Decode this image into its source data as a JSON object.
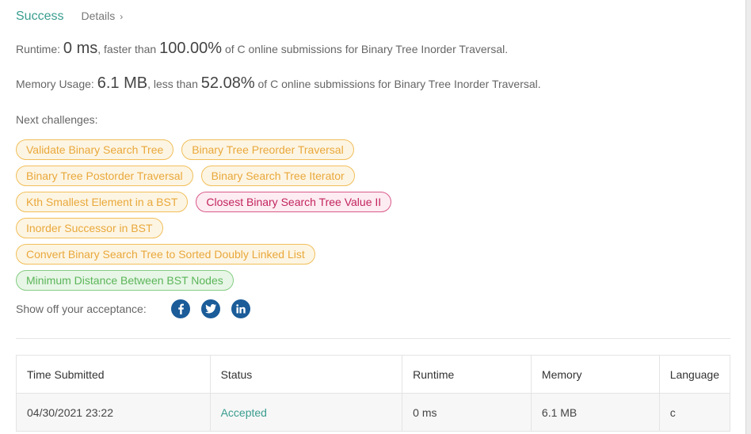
{
  "header": {
    "status": "Success",
    "details_label": "Details",
    "details_chevron": "›"
  },
  "runtime": {
    "label": "Runtime:",
    "value": "0 ms",
    "mid": ", faster than",
    "percent": "100.00%",
    "tail": "of C online submissions for Binary Tree Inorder Traversal."
  },
  "memory": {
    "label": "Memory Usage:",
    "value": "6.1 MB",
    "mid": ", less than",
    "percent": "52.08%",
    "tail": "of C online submissions for Binary Tree Inorder Traversal."
  },
  "next_challenges": {
    "label": "Next challenges:",
    "rows": [
      [
        {
          "title": "Validate Binary Search Tree",
          "difficulty": "medium"
        },
        {
          "title": "Binary Tree Preorder Traversal",
          "difficulty": "medium"
        }
      ],
      [
        {
          "title": "Binary Tree Postorder Traversal",
          "difficulty": "medium"
        },
        {
          "title": "Binary Search Tree Iterator",
          "difficulty": "medium"
        }
      ],
      [
        {
          "title": "Kth Smallest Element in a BST",
          "difficulty": "medium"
        },
        {
          "title": "Closest Binary Search Tree Value II",
          "difficulty": "hard"
        }
      ],
      [
        {
          "title": "Inorder Successor in BST",
          "difficulty": "medium"
        }
      ],
      [
        {
          "title": "Convert Binary Search Tree to Sorted Doubly Linked List",
          "difficulty": "medium"
        }
      ],
      [
        {
          "title": "Minimum Distance Between BST Nodes",
          "difficulty": "easy"
        }
      ]
    ]
  },
  "share": {
    "label": "Show off your acceptance:",
    "icons": [
      "facebook-icon",
      "twitter-icon",
      "linkedin-icon"
    ]
  },
  "table": {
    "columns": [
      "Time Submitted",
      "Status",
      "Runtime",
      "Memory",
      "Language"
    ],
    "rows": [
      {
        "time": "04/30/2021 23:22",
        "status": "Accepted",
        "runtime": "0 ms",
        "memory": "6.1 MB",
        "language": "c"
      }
    ]
  },
  "colors": {
    "success": "#3a9d8f",
    "medium_tag": "#e9a83b",
    "hard_tag": "#c3245f",
    "easy_tag": "#5bb559",
    "social": "#1b5c99"
  }
}
